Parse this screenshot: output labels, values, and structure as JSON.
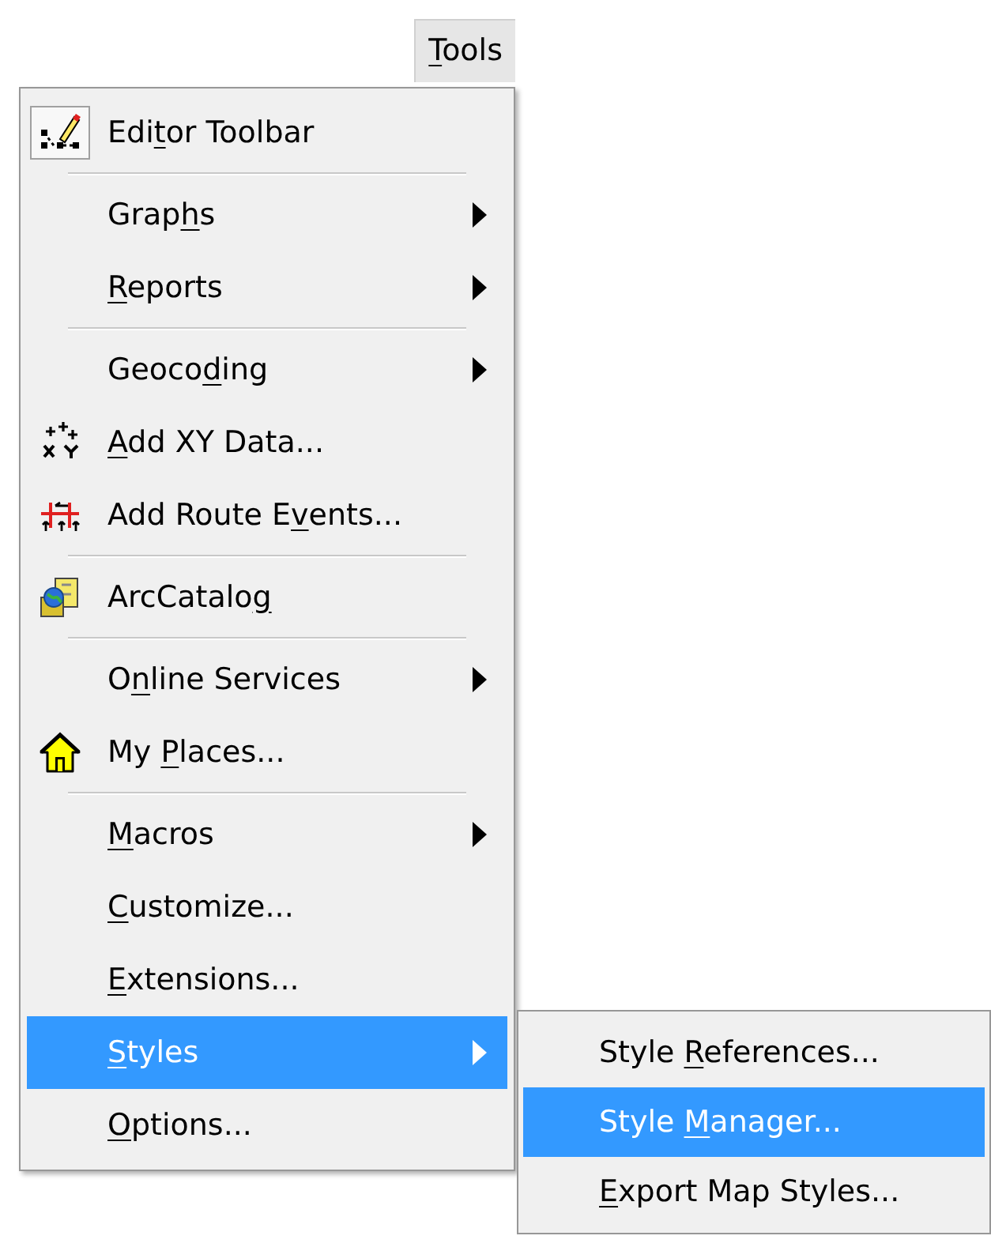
{
  "menu_bar": {
    "open": true,
    "label": {
      "key": "T",
      "after": "ools"
    }
  },
  "menu": {
    "groups": [
      [
        {
          "checked": true,
          "selected": false,
          "submenu": false,
          "label": {
            "before": "Edi",
            "key": "t",
            "after": "or Toolbar"
          }
        }
      ],
      [
        {
          "checked": false,
          "selected": false,
          "submenu": true,
          "label": {
            "before": "Grap",
            "key": "h",
            "after": "s"
          }
        },
        {
          "checked": false,
          "selected": false,
          "submenu": true,
          "label": {
            "key": "R",
            "after": "eports"
          }
        }
      ],
      [
        {
          "checked": false,
          "selected": false,
          "submenu": true,
          "label": {
            "before": "Geoco",
            "key": "d",
            "after": "ing"
          }
        },
        {
          "checked": false,
          "selected": false,
          "submenu": false,
          "label": {
            "key": "A",
            "after": "dd XY Data..."
          }
        },
        {
          "checked": false,
          "selected": false,
          "submenu": false,
          "label": {
            "before": "Add Route E",
            "key": "v",
            "after": "ents..."
          }
        }
      ],
      [
        {
          "checked": false,
          "selected": false,
          "submenu": false,
          "label": {
            "before": "ArcCatalo",
            "key": "g"
          }
        }
      ],
      [
        {
          "checked": false,
          "selected": false,
          "submenu": true,
          "label": {
            "before": "O",
            "key": "n",
            "after": "line Services"
          }
        },
        {
          "checked": false,
          "selected": false,
          "submenu": false,
          "label": {
            "before": "My ",
            "key": "P",
            "after": "laces..."
          }
        }
      ],
      [
        {
          "checked": false,
          "selected": false,
          "submenu": true,
          "label": {
            "key": "M",
            "after": "acros"
          }
        },
        {
          "checked": false,
          "selected": false,
          "submenu": false,
          "label": {
            "key": "C",
            "after": "ustomize..."
          }
        },
        {
          "checked": false,
          "selected": false,
          "submenu": false,
          "label": {
            "key": "E",
            "after": "xtensions..."
          }
        },
        {
          "checked": false,
          "selected": true,
          "submenu": true,
          "label": {
            "key": "S",
            "after": "tyles"
          },
          "children": [
            {
              "selected": false,
              "label": {
                "before": "Style ",
                "key": "R",
                "after": "eferences..."
              }
            },
            {
              "selected": true,
              "label": {
                "before": "Style ",
                "key": "M",
                "after": "anager..."
              }
            },
            {
              "selected": false,
              "label": {
                "key": "E",
                "after": "xport Map Styles..."
              }
            }
          ]
        },
        {
          "checked": false,
          "selected": false,
          "submenu": false,
          "label": {
            "key": "O",
            "after": "ptions..."
          }
        }
      ]
    ]
  }
}
